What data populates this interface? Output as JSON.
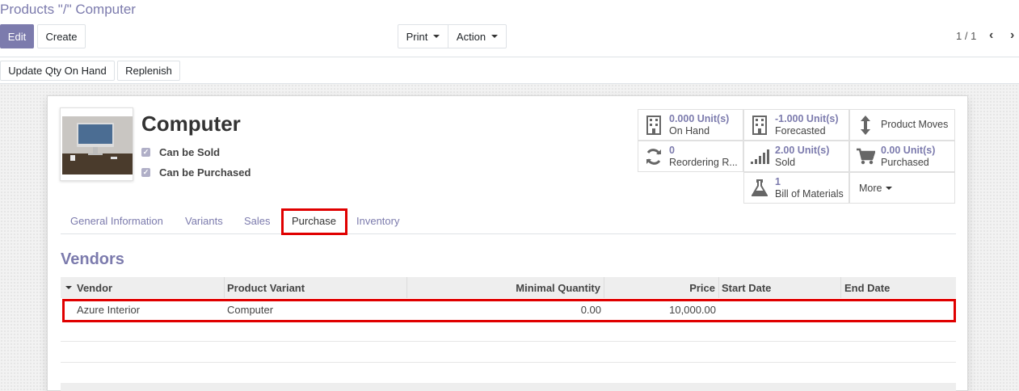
{
  "breadcrumb": "Products \"/\" Computer",
  "toolbar": {
    "edit": "Edit",
    "create": "Create",
    "print": "Print",
    "action": "Action",
    "pager": "1 / 1"
  },
  "subbar": {
    "update_qty": "Update Qty On Hand",
    "replenish": "Replenish"
  },
  "product": {
    "name": "Computer",
    "can_be_sold": "Can be Sold",
    "can_be_purchased": "Can be Purchased"
  },
  "smart_buttons": {
    "on_hand_value": "0.000 Unit(s)",
    "on_hand_label": "On Hand",
    "forecasted_value": "-1.000 Unit(s)",
    "forecasted_label": "Forecasted",
    "product_moves": "Product Moves",
    "reordering_value": "0",
    "reordering_label": "Reordering R...",
    "sold_value": "2.00 Unit(s)",
    "sold_label": "Sold",
    "purchased_value": "0.00 Unit(s)",
    "purchased_label": "Purchased",
    "bom_value": "1",
    "bom_label": "Bill of Materials",
    "more": "More"
  },
  "tabs": [
    "General Information",
    "Variants",
    "Sales",
    "Purchase",
    "Inventory"
  ],
  "vendors": {
    "title": "Vendors",
    "columns": [
      "Vendor",
      "Product Variant",
      "Minimal Quantity",
      "Price",
      "Start Date",
      "End Date"
    ],
    "rows": [
      {
        "vendor": "Azure Interior",
        "variant": "Computer",
        "min_qty": "0.00",
        "price": "10,000.00",
        "start": "",
        "end": ""
      }
    ]
  },
  "colors": {
    "accent": "#7c7bad",
    "highlight": "#e00000"
  }
}
